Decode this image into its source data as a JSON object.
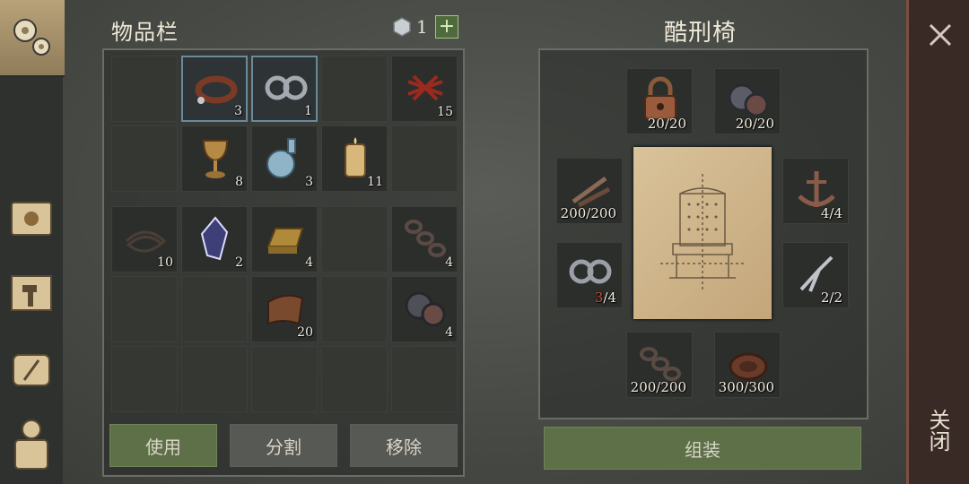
{
  "inventory": {
    "title": "物品栏",
    "currency_count": "1",
    "add_label": "+",
    "slots_top": [
      {
        "icon": "empty-slot",
        "count": ""
      },
      {
        "icon": "leather-collar-icon",
        "count": "3",
        "selected": true
      },
      {
        "icon": "shackles-icon",
        "count": "1",
        "selected": true
      },
      {
        "icon": "empty-slot",
        "count": ""
      },
      {
        "icon": "red-lace-icon",
        "count": "15"
      },
      {
        "icon": "empty-slot",
        "count": ""
      },
      {
        "icon": "goblet-icon",
        "count": "8"
      },
      {
        "icon": "potion-bottle-icon",
        "count": "3"
      },
      {
        "icon": "candle-icon",
        "count": "11"
      },
      {
        "icon": "empty-slot",
        "count": ""
      }
    ],
    "slots_bottom": [
      {
        "icon": "rope-icon",
        "count": "10"
      },
      {
        "icon": "crystal-icon",
        "count": "2"
      },
      {
        "icon": "gold-ingot-icon",
        "count": "4"
      },
      {
        "icon": "empty-slot",
        "count": ""
      },
      {
        "icon": "chain-icon",
        "count": "4"
      },
      {
        "icon": "empty-slot",
        "count": ""
      },
      {
        "icon": "empty-slot",
        "count": ""
      },
      {
        "icon": "leather-scroll-icon",
        "count": "20"
      },
      {
        "icon": "empty-slot",
        "count": ""
      },
      {
        "icon": "gear-icon",
        "count": "4"
      }
    ],
    "buttons": {
      "use": "使用",
      "split": "分割",
      "remove": "移除"
    }
  },
  "craft": {
    "title": "酷刑椅",
    "ingredients": {
      "lock": "20/20",
      "gears": "20/20",
      "nails": "200/200",
      "anchor": "4/4",
      "shackles_have": "3",
      "shackles_need": "/4",
      "pliers": "2/2",
      "chain": "200/200",
      "leather": "300/300"
    },
    "assemble_label": "组装"
  },
  "close_label": "关闭",
  "colors": {
    "accent_green": "#5d7048",
    "close_bg": "#3a2a26",
    "highlight_red": "#d94a3a"
  }
}
